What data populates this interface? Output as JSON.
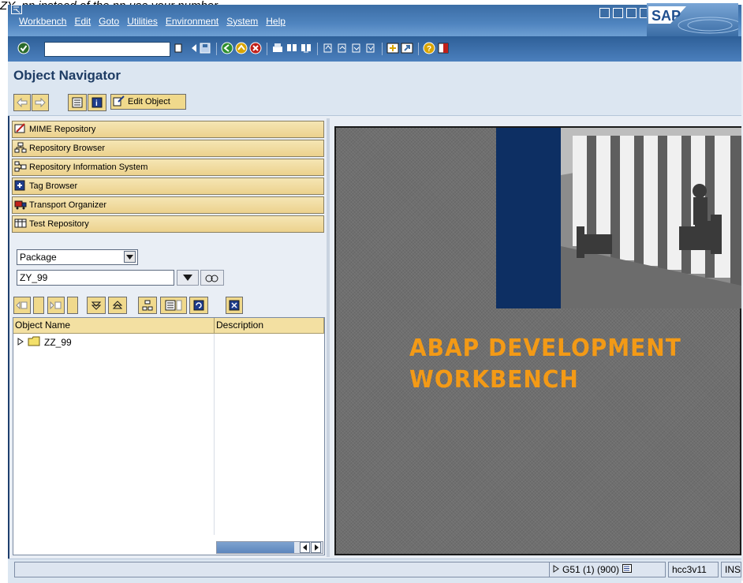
{
  "caption": "ZY_nn instead of the nn use your number.",
  "menu": [
    "Workbench",
    "Edit",
    "Goto",
    "Utilities",
    "Environment",
    "System",
    "Help"
  ],
  "brand": "SAP",
  "toolbar": {
    "command_value": ""
  },
  "page_title": "Object Navigator",
  "app_toolbar": {
    "edit_object_label": "Edit Object"
  },
  "nav_tabs": [
    {
      "label": "MIME Repository",
      "icon": "mime-icon"
    },
    {
      "label": "Repository Browser",
      "icon": "hierarchy-icon"
    },
    {
      "label": "Repository Information System",
      "icon": "info-system-icon"
    },
    {
      "label": "Tag Browser",
      "icon": "tag-icon"
    },
    {
      "label": "Transport Organizer",
      "icon": "truck-icon"
    },
    {
      "label": "Test Repository",
      "icon": "test-icon"
    }
  ],
  "object_type": "Package",
  "object_name": "ZY_99",
  "tree": {
    "columns": [
      "Object Name",
      "Description"
    ],
    "rows": [
      {
        "name": "ZZ_99",
        "description": ""
      }
    ]
  },
  "banner": {
    "line1": "ABAP DEVELOPMENT",
    "line2": "WORKBENCH"
  },
  "status": {
    "system": "G51 (1) (900)",
    "server": "hcc3v11",
    "mode": "INS"
  },
  "colors": {
    "menu_blue": "#3b6da5",
    "tab_gold": "#ecd28d",
    "banner_orange": "#f39a16"
  }
}
